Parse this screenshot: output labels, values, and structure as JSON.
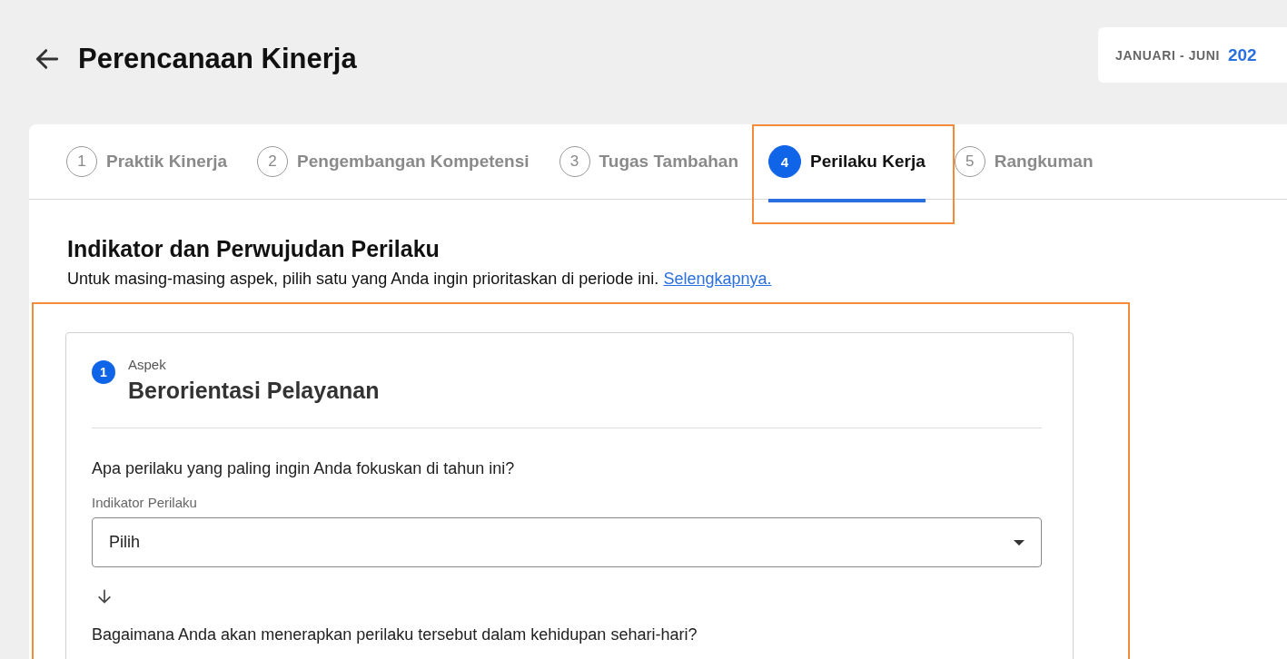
{
  "header": {
    "title": "Perencanaan Kinerja",
    "period_label": "JANUARI - JUNI",
    "period_year": "202"
  },
  "steps": [
    {
      "number": "1",
      "label": "Praktik Kinerja",
      "selected": false
    },
    {
      "number": "2",
      "label": "Pengembangan Kompetensi",
      "selected": false
    },
    {
      "number": "3",
      "label": "Tugas Tambahan",
      "selected": false
    },
    {
      "number": "4",
      "label": "Perilaku Kerja",
      "selected": true
    },
    {
      "number": "5",
      "label": "Rangkuman",
      "selected": false
    }
  ],
  "section": {
    "title": "Indikator dan Perwujudan Perilaku",
    "description": "Untuk masing-masing aspek, pilih satu yang Anda ingin prioritaskan di periode ini.",
    "link": "Selengkapnya."
  },
  "aspect": {
    "number": "1",
    "caption": "Aspek",
    "name": "Berorientasi Pelayanan",
    "question": "Apa perilaku yang paling ingin Anda fokuskan di tahun ini?",
    "field_label": "Indikator Perilaku",
    "field_value": "Pilih",
    "next_question": "Bagaimana Anda akan menerapkan perilaku tersebut dalam kehidupan sehari-hari?"
  }
}
